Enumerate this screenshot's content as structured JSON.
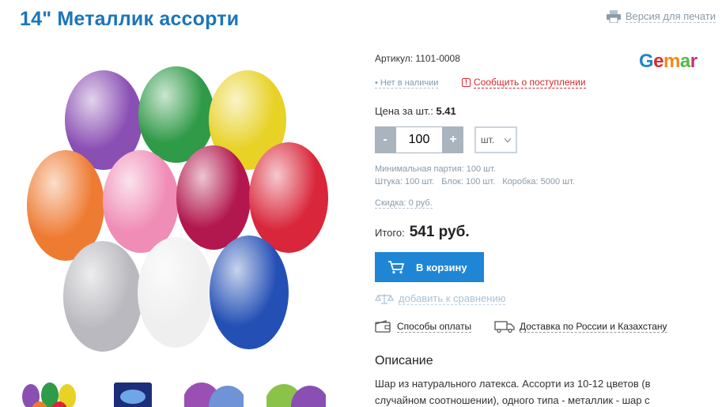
{
  "product": {
    "title": "14\" Металлик ассорти",
    "print_label": "Версия для печати",
    "sku": "Артикул: 1101-0008",
    "brand": [
      "G",
      "e",
      "m",
      "a",
      "r"
    ],
    "stock_status": "• Нет в наличии",
    "notify_label": "Сообщить о поступлении",
    "price_label": "Цена за шт.:",
    "price_value": "5.41",
    "qty_minus": "-",
    "qty_value": "100",
    "qty_plus": "+",
    "unit_selected": "шт.",
    "min_batch": "Минимальная партия: 100 шт.",
    "pack_info": "Штука: 100 шт.   Блок: 100 шт.   Коробка: 5000 шт.",
    "discount": "Скидка: 0 руб.",
    "total_label": "Итого:",
    "total_value": "541 руб.",
    "cart_label": "В корзину",
    "compare_label": "добавить к сравнению",
    "payment_label": "Способы оплаты",
    "delivery_label": "Доставка по России и Казахстану",
    "description_heading": "Описание",
    "description_text": "Шар из натурального латекса. Ассорти из 10-12 цветов (в случайном соотношении), одного типа - металлик - шар с"
  },
  "colors": {
    "title": "#1b75bb",
    "cart_button": "#1f86d6",
    "notify": "#d9262c",
    "muted": "#8a9aa8"
  },
  "balloons": [
    "#8a4fb3",
    "#2f9a47",
    "#e8d226",
    "#ee7b32",
    "#f08db6",
    "#b2184d",
    "#d9263a",
    "#b9b9bf",
    "#efefef",
    "#2450b5"
  ]
}
